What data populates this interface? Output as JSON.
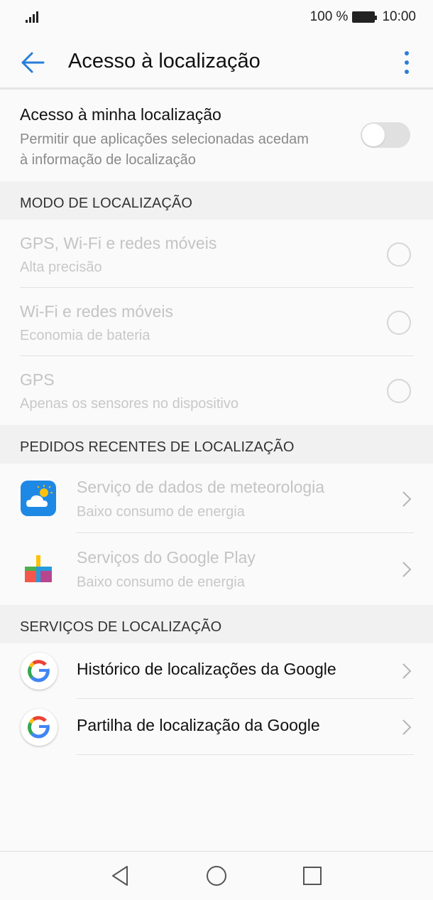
{
  "status_bar": {
    "battery_text": "100 %",
    "time": "10:00"
  },
  "app_bar": {
    "title": "Acesso à localização"
  },
  "location_access": {
    "title": "Acesso à minha localização",
    "subtitle_line1": "Permitir que aplicações selecionadas acedam",
    "subtitle_line2": "à informação de localização",
    "enabled": false
  },
  "mode_section": {
    "header": "MODO DE LOCALIZAÇÃO",
    "options": [
      {
        "title": "GPS, Wi-Fi e redes móveis",
        "subtitle": "Alta precisão"
      },
      {
        "title": "Wi-Fi e redes móveis",
        "subtitle": "Economia de bateria"
      },
      {
        "title": "GPS",
        "subtitle": "Apenas os sensores no dispositivo"
      }
    ]
  },
  "recent_section": {
    "header": "PEDIDOS RECENTES DE LOCALIZAÇÃO",
    "items": [
      {
        "title": "Serviço de dados de meteorologia",
        "subtitle": "Baixo consumo de energia",
        "icon": "weather-app-icon"
      },
      {
        "title": "Serviços do Google Play",
        "subtitle": "Baixo consumo de energia",
        "icon": "google-play-services-icon"
      }
    ]
  },
  "services_section": {
    "header": "SERVIÇOS DE LOCALIZAÇÃO",
    "items": [
      {
        "title": "Histórico de localizações da Google",
        "icon": "google-icon"
      },
      {
        "title": "Partilha de localização da Google",
        "icon": "google-icon"
      }
    ]
  },
  "colors": {
    "accent": "#2a7ed8",
    "disabled_text": "#c4c4c4",
    "section_bg": "#f1f1f1"
  }
}
